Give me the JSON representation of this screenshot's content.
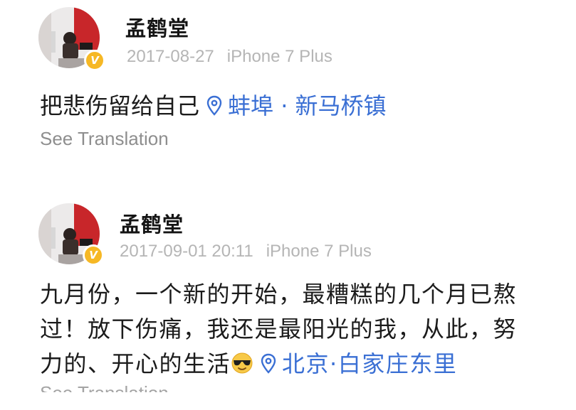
{
  "colors": {
    "username": "#141414",
    "meta": "#b5b5b5",
    "location_link": "#3a6fd4",
    "translation": "#8e8e8e",
    "verified_badge": "#f6b825"
  },
  "posts": [
    {
      "username": "孟鹤堂",
      "verified_badge": "V",
      "timestamp": "2017-08-27",
      "device": "iPhone 7 Plus",
      "text": "把悲伤留给自己",
      "location": "蚌埠 · 新马桥镇",
      "location_icon": "location-pin-icon",
      "see_translation": "See Translation"
    },
    {
      "username": "孟鹤堂",
      "verified_badge": "V",
      "timestamp": "2017-09-01 20:11",
      "device": "iPhone 7 Plus",
      "text": "九月份，一个新的开始，最糟糕的几个月已熬过！放下伤痛，我还是最阳光的我，从此，努力的、开心的生活",
      "emoji": "sunglasses-emoji",
      "location": "北京·白家庄东里",
      "location_icon": "location-pin-icon",
      "see_translation": "See Translation"
    }
  ]
}
